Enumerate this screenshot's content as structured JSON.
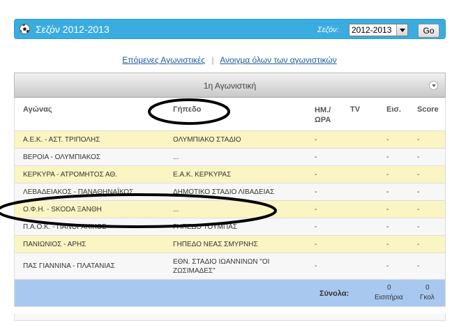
{
  "season_bar": {
    "icon": "soccer-ball-icon",
    "title": "Σεζόν 2012-2013",
    "label": "Σεζόν:",
    "selected": "2012-2013",
    "go_label": "Go"
  },
  "links": {
    "next_rounds": "Επόμενες Αγωνιστικές",
    "separator": "|",
    "open_all": "Ανοιγμα όλων των αγωνιστικών"
  },
  "round": {
    "title": "1η Αγωνιστική"
  },
  "columns": {
    "match": "Αγώνας",
    "venue": "Γήπεδο",
    "time": "ΗΜ./\nΩΡΑ",
    "tv": "TV",
    "spectators": "Εισ.",
    "score": "Score"
  },
  "rows": [
    {
      "match": "Α.Ε.Κ. - ΑΣΤ. ΤΡΙΠΟΛΗΣ",
      "venue": "ΟΛΥΜΠΙΑΚΟ ΣΤΑΔΙΟ",
      "time": "-",
      "tv": "",
      "spectators": "-",
      "score": "-"
    },
    {
      "match": "ΒΕΡΟΙΑ - ΟΛΥΜΠΙΑΚΟΣ",
      "venue": "...",
      "time": "-",
      "tv": "",
      "spectators": "-",
      "score": "-"
    },
    {
      "match": "ΚΕΡΚΥΡΑ - ΑΤΡΟΜΗΤΟΣ ΑΘ.",
      "venue": "Ε.Α.Κ. ΚΕΡΚΥΡΑΣ",
      "time": "-",
      "tv": "",
      "spectators": "-",
      "score": "-"
    },
    {
      "match": "ΛΕΒΑΔΕΙΑΚΟΣ - ΠΑΝΑΘΗΝΑΪΚΟΣ",
      "venue": "ΔΗΜΟΤΙΚΟ ΣΤΑΔΙΟ ΛΙΒΑΔΕΙΑΣ",
      "time": "-",
      "tv": "",
      "spectators": "-",
      "score": "-"
    },
    {
      "match": "Ο.Φ.Η. - SKODA ΞΑΝΘΗ",
      "venue": "...",
      "time": "-",
      "tv": "",
      "spectators": "-",
      "score": "-"
    },
    {
      "match": "Π.Α.Ο.Κ. - ΠΑΝΘΡΑΚΙΚΟΣ",
      "venue": "ΓΗΠΕΔΟ ΤΟΥΜΠΑΣ",
      "time": "-",
      "tv": "",
      "spectators": "-",
      "score": "-"
    },
    {
      "match": "ΠΑΝΙΩΝΙΟΣ - ΑΡΗΣ",
      "venue": "ΓΗΠΕΔΟ ΝΕΑΣ ΣΜΥΡΝΗΣ",
      "time": "-",
      "tv": "",
      "spectators": "-",
      "score": "-"
    },
    {
      "match": "ΠΑΣ ΓΙΑΝΝΙΝΑ - ΠΛΑΤΑΝΙΑΣ",
      "venue_line1": "ΕΘΝ. ΣΤΑΔΙΟ ΙΩΑΝΝΙΝΩΝ \"ΟΙ",
      "venue_line2": "ΖΩΣΙΜΑΔΕΣ\"",
      "time": "-",
      "tv": "",
      "spectators": "-",
      "score": "-"
    }
  ],
  "totals": {
    "label": "Σύνολα:",
    "spectators_value": "0",
    "spectators_caption": "Εισιτήρια",
    "goals_value": "0",
    "goals_caption": "Γκολ"
  },
  "colors": {
    "season_bar": "#3aace0",
    "row_yellow": "#faf5c2",
    "row_white": "#f7f7f7",
    "totals_bg": "#a8c8f0",
    "link": "#1e5a96",
    "annotation": "#000000"
  }
}
